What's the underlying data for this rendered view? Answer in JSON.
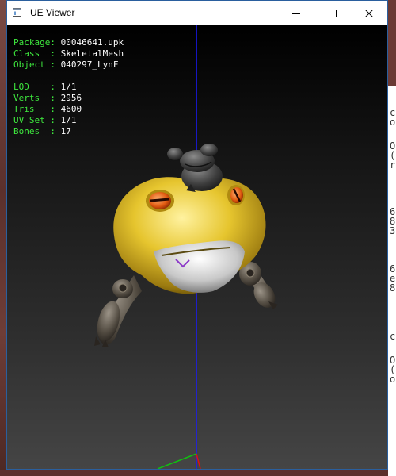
{
  "window": {
    "title": "UE Viewer",
    "icon": "app-window-icon"
  },
  "titlebar_buttons": [
    "minimize-icon",
    "maximize-icon",
    "close-icon"
  ],
  "info": {
    "package": {
      "label": "Package:",
      "value": "00046641.upk"
    },
    "class": {
      "label": "Class  :",
      "value": "SkeletalMesh"
    },
    "object": {
      "label": "Object :",
      "value": "040297_LynF"
    },
    "lod": {
      "label": "LOD    :",
      "value": "1/1"
    },
    "verts": {
      "label": "Verts  :",
      "value": "2956"
    },
    "tris": {
      "label": "Tris   :",
      "value": "4600"
    },
    "uvset": {
      "label": "UV Set :",
      "value": "1/1"
    },
    "bones": {
      "label": "Bones  :",
      "value": "17"
    }
  },
  "colors": {
    "label_green": "#3ee83e",
    "value_white": "#ffffff",
    "axis_blue": "#1a1aff",
    "axis_red": "#e01010",
    "axis_green": "#10c010"
  },
  "background_window": {
    "chars": [
      "c",
      "o",
      "O",
      "(",
      "r",
      "6",
      "8",
      "3",
      "6",
      "e",
      "8",
      "c",
      "O",
      "(",
      "o"
    ]
  }
}
